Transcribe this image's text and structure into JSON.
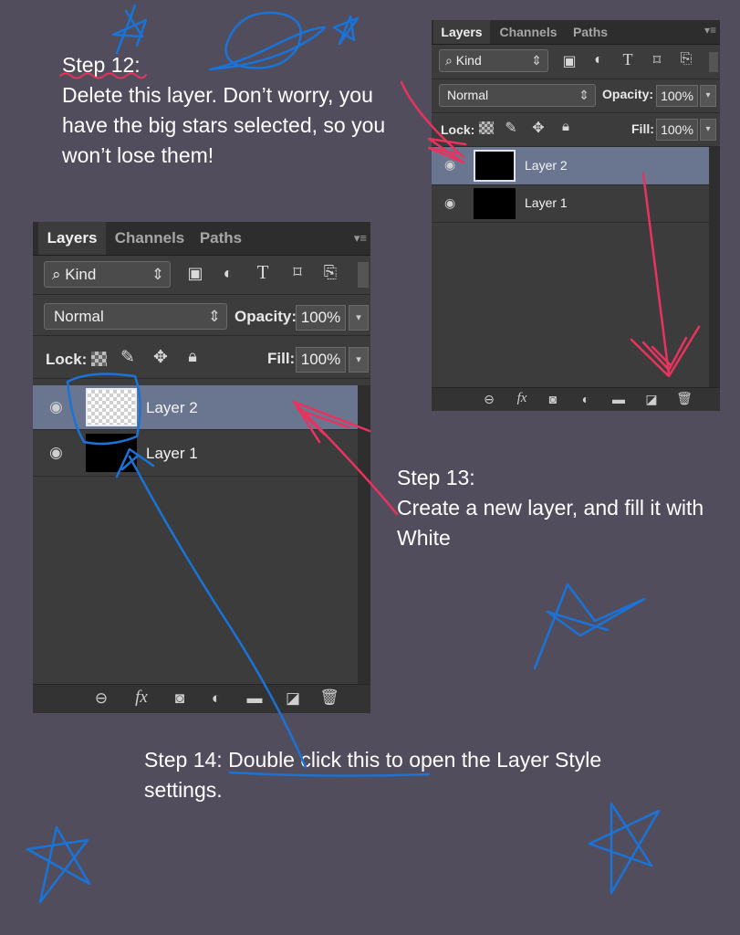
{
  "step12": {
    "title": "Step 12:",
    "text": "Delete this layer. Don’t worry, you have the big stars selected, so you won’t lose them!"
  },
  "step13": {
    "title": "Step 13:",
    "text": "Create a new layer, and fill it with White"
  },
  "step14": {
    "prefix": "Step 14: ",
    "highlight": "Double click this to",
    "suffix": " open the Layer Style settings."
  },
  "panel": {
    "tabs": [
      "Layers",
      "Channels",
      "Paths"
    ],
    "filter_kind": "Kind",
    "blend_mode": "Normal",
    "opacity_label": "Opacity:",
    "opacity_value": "100%",
    "lock_label": "Lock:",
    "fill_label": "Fill:",
    "fill_value": "100%",
    "layers": [
      {
        "name": "Layer 2",
        "selected": true
      },
      {
        "name": "Layer 1",
        "selected": false
      }
    ],
    "filter_icons": [
      "image-filter-icon",
      "adjustment-filter-icon",
      "type-filter-icon",
      "shape-filter-icon",
      "smart-object-filter-icon"
    ],
    "lock_icons": [
      "lock-transparent-icon",
      "lock-brush-icon",
      "lock-position-icon",
      "lock-all-icon"
    ],
    "bottom_icons": [
      "link-icon",
      "fx-icon",
      "mask-icon",
      "adjustment-icon",
      "group-folder-icon",
      "new-layer-icon",
      "trash-icon"
    ]
  },
  "colors": {
    "background": "#524d5c",
    "pink_annotation": "#e8335f",
    "blue_annotation": "#1a73d6",
    "selected_layer": "#6a7590"
  }
}
